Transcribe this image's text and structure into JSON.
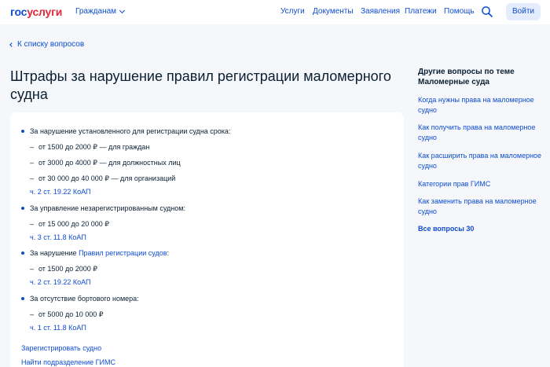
{
  "header": {
    "logo_part1": "гос",
    "logo_part2": "услуги",
    "audience": "Гражданам",
    "nav": [
      "Услуги",
      "Документы",
      "Заявления",
      "Платежи",
      "Помощь"
    ],
    "login": "Войти",
    "search_icon": "search-icon"
  },
  "back_link": "К списку вопросов",
  "title": "Штрафы за нарушение правил регистрации маломерного судна",
  "fines": [
    {
      "text": "За нарушение установленного для регистрации судна срока:",
      "items": [
        "от 1500 до 2000 ₽ — для граждан",
        "от 3000 до 4000 ₽ — для должностных лиц",
        "от 30 000 до 40 000 ₽ — для организаций"
      ],
      "law": "ч. 2 ст. 19.22 КоАП"
    },
    {
      "text": "За управление незарегистрированным судном:",
      "items": [
        "от 15 000 до 20 000 ₽"
      ],
      "law": "ч. 3 ст. 11.8 КоАП"
    },
    {
      "text_prefix": "За нарушение ",
      "text_link": "Правил регистрации судов",
      "text_suffix": ":",
      "items": [
        "от 1500 до 2000 ₽"
      ],
      "law": "ч. 2 ст. 19.22 КоАП"
    },
    {
      "text": "За отсутствие бортового номера:",
      "items": [
        "от 5000 до 10 000 ₽"
      ],
      "law": "ч. 1 ст. 11.8 КоАП"
    }
  ],
  "actions": [
    "Зарегистрировать судно",
    "Найти подразделение ГИМС"
  ],
  "sidebar": {
    "title": "Другие вопросы по теме Маломерные суда",
    "links": [
      "Когда нужны права на маломерное судно",
      "Как получить права на маломерное судно",
      "Как расширить права на маломерное судно",
      "Категории прав ГИМС",
      "Как заменить права на маломерное судно"
    ],
    "all": "Все вопросы 30"
  },
  "colors": {
    "accent": "#0d4cd3",
    "logo_red": "#e3283c",
    "text": "#0b1f33",
    "background": "#f5f7fa"
  }
}
